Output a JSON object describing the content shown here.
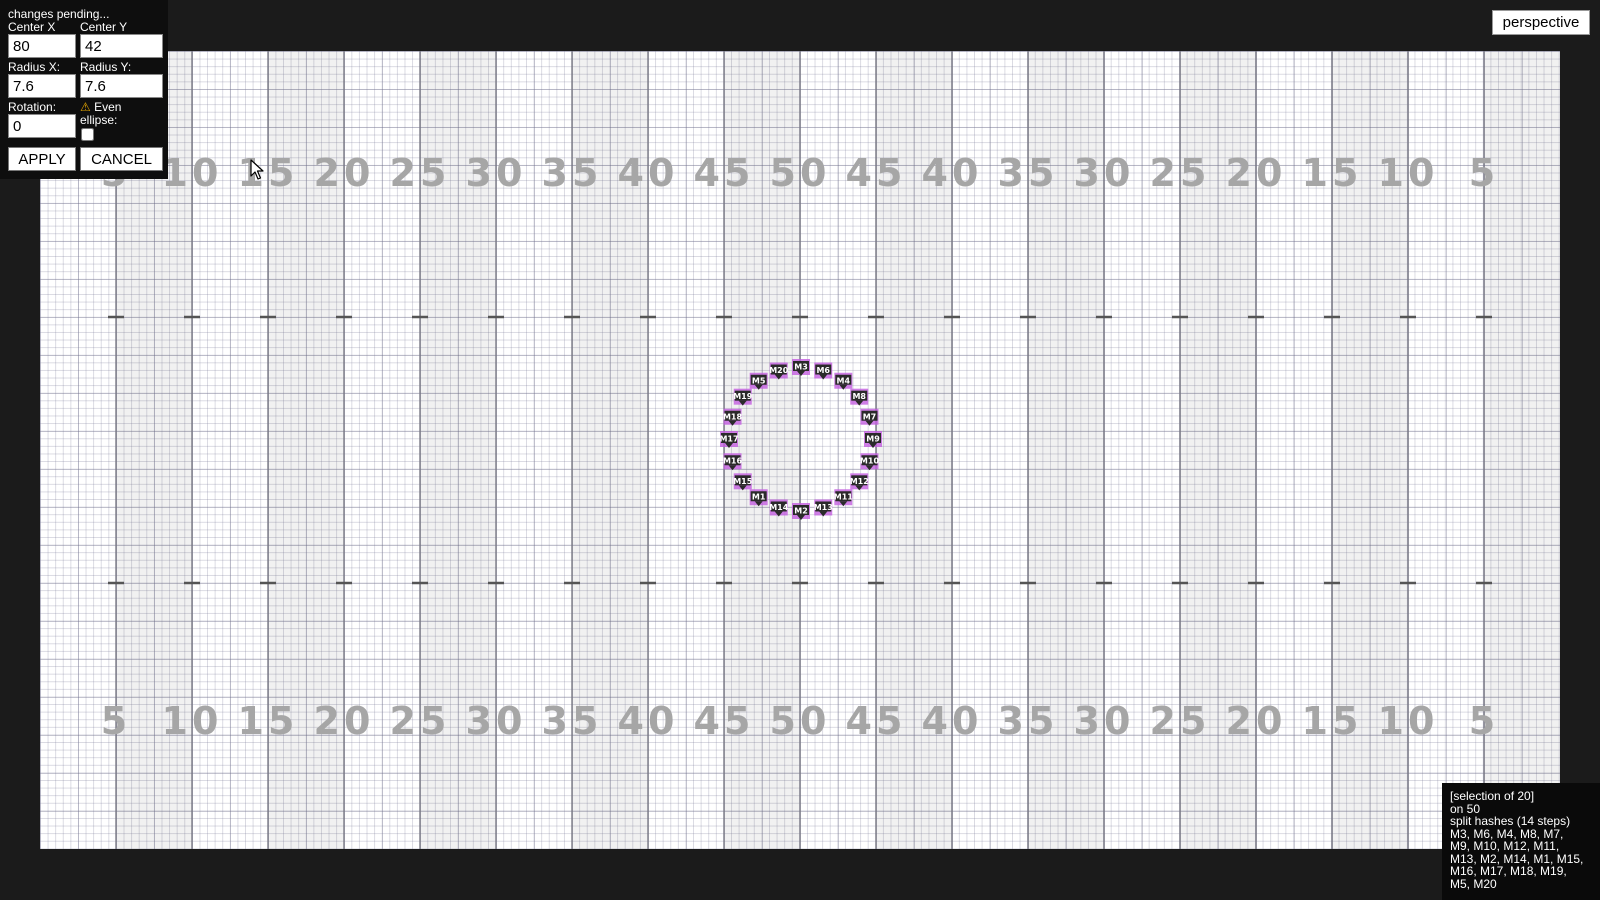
{
  "panel": {
    "status": "changes pending...",
    "center_x_label": "Center X",
    "center_y_label": "Center Y",
    "center_x": "80",
    "center_y": "42",
    "radius_x_label": "Radius X:",
    "radius_y_label": "Radius Y:",
    "radius_x": "7.6",
    "radius_y": "7.6",
    "rotation_label": "Rotation:",
    "rotation": "0",
    "even_ellipse_label_1": "Even",
    "even_ellipse_label_2": "ellipse:",
    "even_ellipse_checked": false,
    "apply_label": "APPLY",
    "cancel_label": "CANCEL"
  },
  "perspective_label": "perspective",
  "field": {
    "yard_numbers": [
      "5",
      "10",
      "15",
      "20",
      "25",
      "30",
      "35",
      "40",
      "45",
      "50",
      "45",
      "40",
      "35",
      "30",
      "25",
      "20",
      "15",
      "10",
      "5"
    ],
    "marcher_color": "#c35ee0",
    "marchers": [
      "M3",
      "M6",
      "M4",
      "M8",
      "M7",
      "M9",
      "M10",
      "M12",
      "M11",
      "M13",
      "M2",
      "M14",
      "M1",
      "M15",
      "M16",
      "M17",
      "M18",
      "M19",
      "M5",
      "M20"
    ]
  },
  "info": {
    "lines": [
      "[selection of 20]",
      "on 50",
      "split hashes (14 steps)",
      "M3, M6, M4, M8, M7,",
      "M9, M10, M12, M11,",
      "M13, M2, M14, M1, M15,",
      "M16, M17, M18, M19,",
      "M5, M20"
    ]
  },
  "icons": {
    "cursor": "mouse-pointer-icon",
    "warning": "warning-icon"
  }
}
